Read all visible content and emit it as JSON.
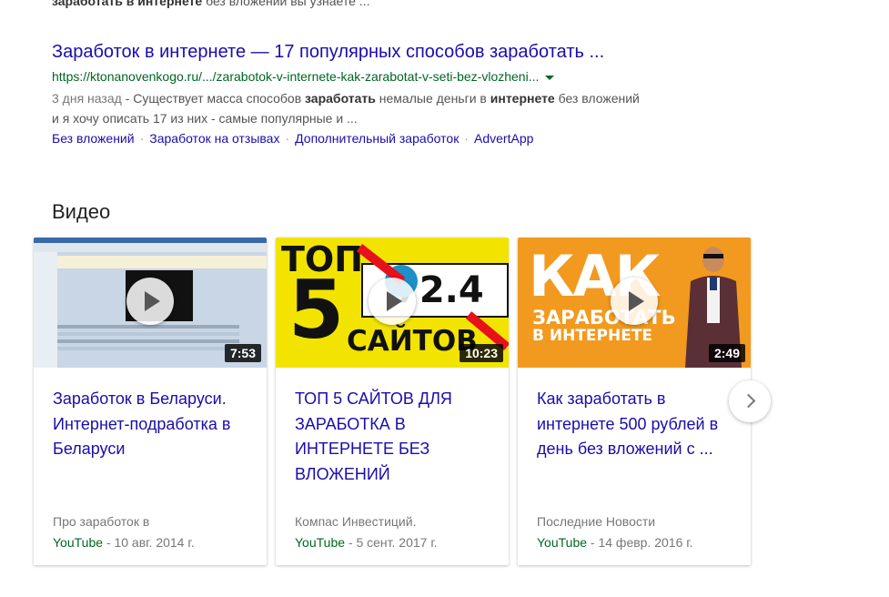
{
  "prev_snippet": {
    "bold_text": "заработать в интернете",
    "rest": " без вложении вы узнаете ..."
  },
  "result": {
    "title": "Заработок в интернете — 17 популярных способов заработать ...",
    "url": "https://ktonanovenkogo.ru/.../zarabotok-v-internete-kak-zarabotat-v-seti-bez-vlozheni...",
    "date": "3 дня назад",
    "snippet_parts": [
      "Существует масса способов ",
      "заработать",
      " немалые деньги в ",
      "интернете",
      " без вложений",
      "и я хочу описать 17 из них - самые популярные и ..."
    ],
    "sitelinks": [
      "Без вложений",
      "Заработок на отзывах",
      "Дополнительный заработок",
      "AdvertApp"
    ]
  },
  "videos_heading": "Видео",
  "videos": [
    {
      "title": "Заработок в Беларуси. Интернет-подработка в Беларуси",
      "duration": "7:53",
      "source": "Про заработок в",
      "platform": "YouTube",
      "date": " - 10 авг. 2014 г."
    },
    {
      "title": "ТОП 5 САЙТОВ ДЛЯ ЗАРАБОТКА В ИНТЕРНЕТЕ БЕЗ ВЛОЖЕНИЙ",
      "duration": "10:23",
      "source": "Компас Инвестиций.",
      "platform": "YouTube",
      "date": " - 5 сент. 2017 г.",
      "thumb_text": {
        "top": "ТОП",
        "five": "5",
        "sites": "САЙТОВ",
        "money": "72.4"
      }
    },
    {
      "title": "Как заработать в интернете 500 рублей в день без вложений с ...",
      "duration": "2:49",
      "source": "Последние Новости",
      "platform": "YouTube",
      "date": " - 14 февр. 2016 г.",
      "thumb_text": {
        "kak": "КАК",
        "line2": "ЗАРАБОТАТЬ",
        "line3": "В ИНТЕРНЕТЕ"
      }
    }
  ],
  "colors": {
    "link": "#1a0dab",
    "url": "#006621",
    "snippet": "#545454"
  },
  "icons": {
    "next": "chevron-right-icon",
    "play": "play-icon",
    "url_dropdown": "caret-down-icon"
  }
}
